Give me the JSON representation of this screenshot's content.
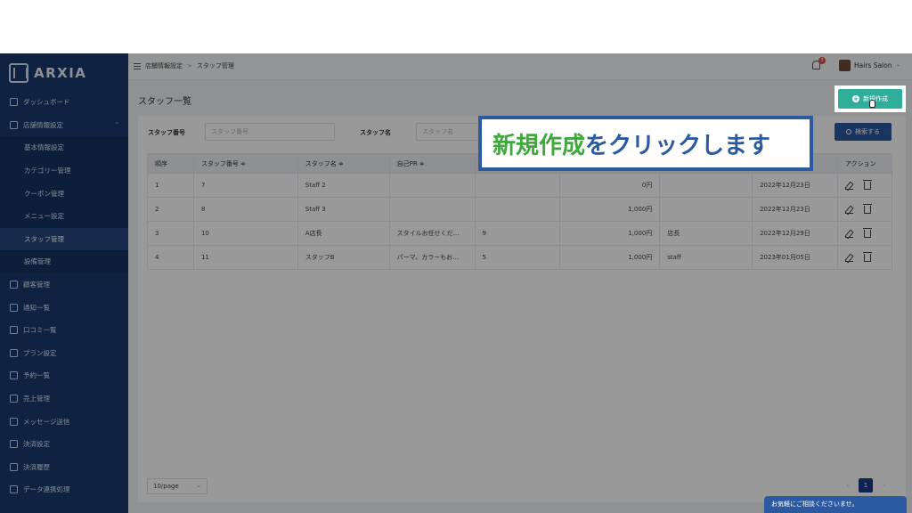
{
  "app": {
    "logo": "ARXIA"
  },
  "sidebar": {
    "items": [
      {
        "label": "ダッシュボード"
      },
      {
        "label": "店舗情報設定"
      },
      {
        "label": "顧客管理"
      },
      {
        "label": "通知一覧"
      },
      {
        "label": "口コミ一覧"
      },
      {
        "label": "プラン設定"
      },
      {
        "label": "予約一覧"
      },
      {
        "label": "売上管理"
      },
      {
        "label": "メッセージ送信"
      },
      {
        "label": "決済設定"
      },
      {
        "label": "決済履歴"
      },
      {
        "label": "データ連携処理"
      }
    ],
    "sub_items": [
      {
        "label": "基本情報設定"
      },
      {
        "label": "カテゴリー管理"
      },
      {
        "label": "クーポン管理"
      },
      {
        "label": "メニュー設定"
      },
      {
        "label": "スタッフ管理"
      },
      {
        "label": "設備管理"
      }
    ]
  },
  "header": {
    "breadcrumb": [
      "店舗情報設定",
      "スタッフ管理"
    ],
    "notification_count": "3",
    "user_name": "Hairs Salon"
  },
  "page": {
    "title": "スタッフ一覧",
    "new_button": "新規作成",
    "filters": {
      "staff_no_label": "スタッフ番号",
      "staff_no_placeholder": "スタッフ番号",
      "staff_name_label": "スタッフ名",
      "staff_name_placeholder": "スタッフ名"
    },
    "search_button": "検索する"
  },
  "table": {
    "headers": [
      "順序",
      "スタッフ番号 ≑",
      "スタッフ名 ≑",
      "自己PR ≑",
      "",
      "",
      "",
      "",
      "アクション"
    ],
    "rows": [
      [
        "1",
        "7",
        "Staff 2",
        "",
        "",
        "0円",
        "",
        "2022年12月23日"
      ],
      [
        "2",
        "8",
        "Staff 3",
        "",
        "",
        "1,000円",
        "",
        "2022年12月23日"
      ],
      [
        "3",
        "10",
        "A店長",
        "スタイルお任せくだ…",
        "9",
        "1,000円",
        "店長",
        "2022年12月29日"
      ],
      [
        "4",
        "11",
        "スタッフB",
        "パーマ、カラーもお…",
        "5",
        "1,000円",
        "staff",
        "2023年01月05日"
      ]
    ]
  },
  "pagination": {
    "page_size": "10/page",
    "current": "1",
    "prev": "‹",
    "next": "›"
  },
  "callout": {
    "highlight": "新規作成",
    "rest": "をクリックします"
  },
  "chat": {
    "label": "お気軽にご相談くださいませ。"
  }
}
